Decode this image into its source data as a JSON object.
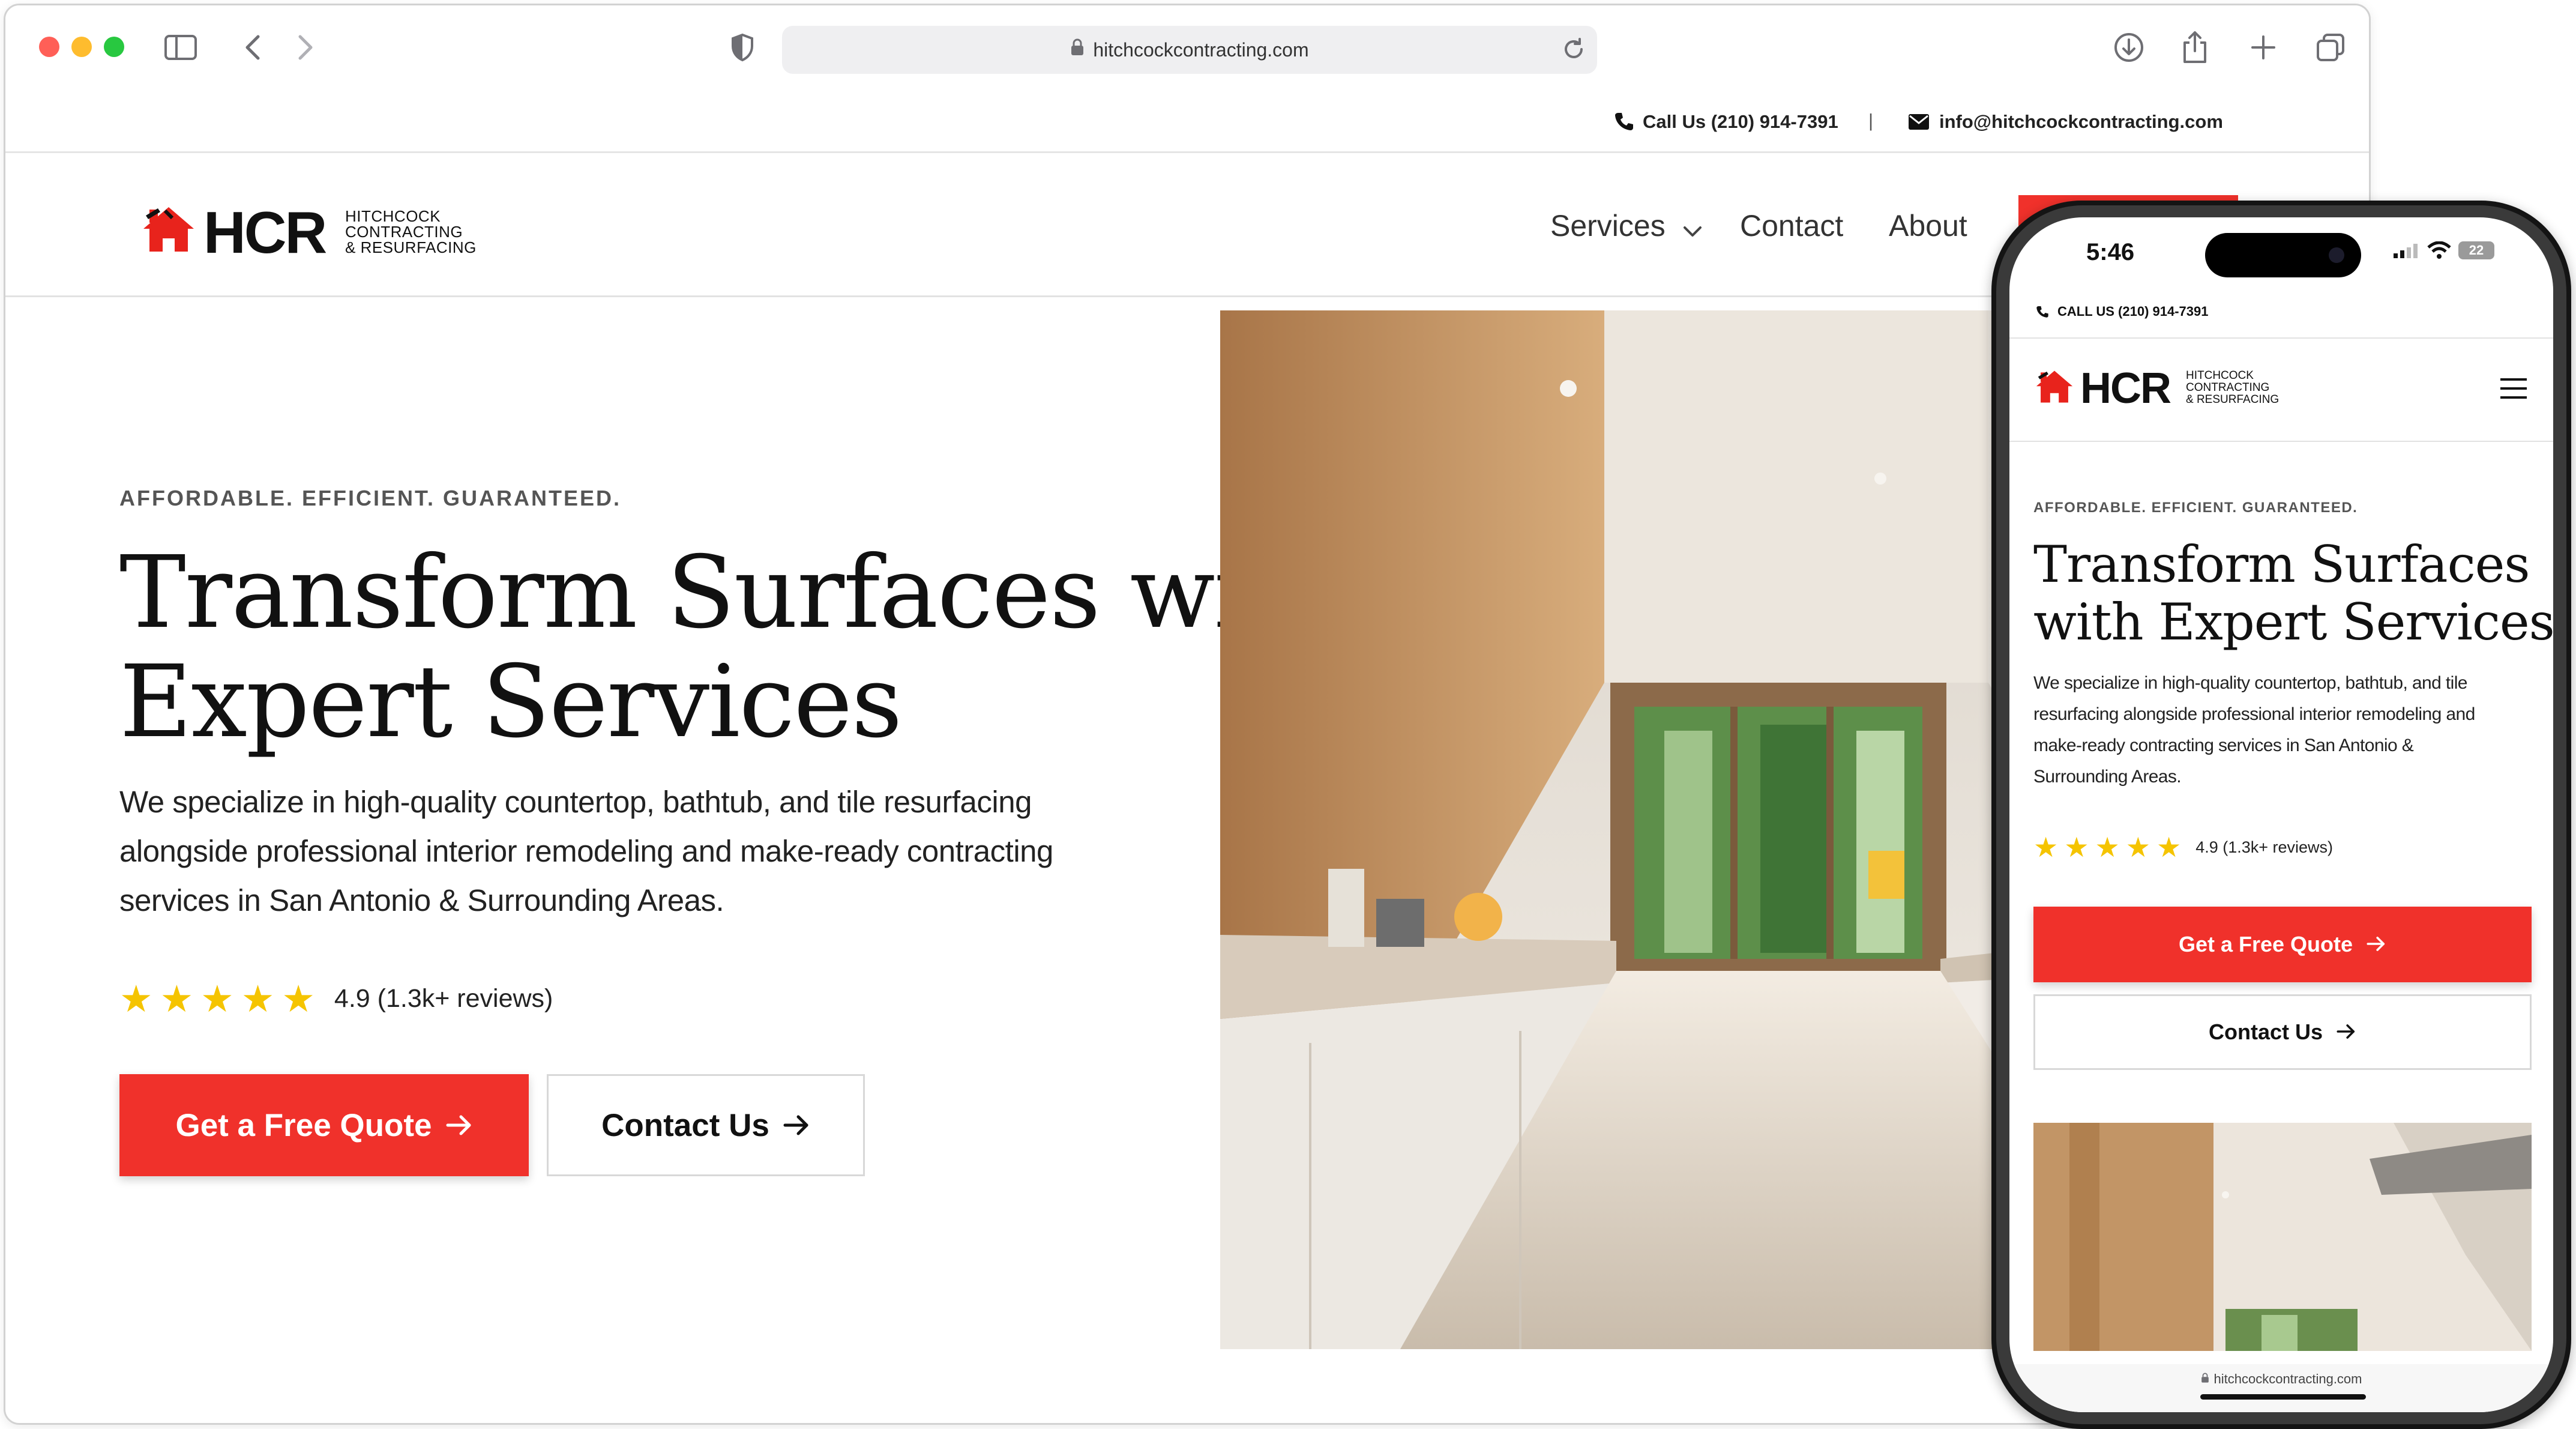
{
  "browser": {
    "url": "hitchcockcontracting.com",
    "controls": [
      "sidebar-icon",
      "back-icon",
      "forward-icon",
      "shield-icon",
      "reload-icon",
      "download-icon",
      "share-icon",
      "new-tab-icon",
      "tabs-icon"
    ]
  },
  "topbar": {
    "phone_label": "Call Us (210) 914-7391",
    "separator": "|",
    "email": "info@hitchcockcontracting.com"
  },
  "logo": {
    "mark": "HCR",
    "line1": "HITCHCOCK",
    "line2": "CONTRACTING",
    "line3": "& RESURFACING"
  },
  "nav": {
    "items": [
      "Services",
      "Contact",
      "About"
    ]
  },
  "hero": {
    "eyebrow": "AFFORDABLE. EFFICIENT. GUARANTEED.",
    "title_line1": "Transform Surfaces with",
    "title_line2": "Expert Services",
    "lead_line1": "We specialize in high-quality countertop, bathtub, and tile resurfacing",
    "lead_line2": "alongside professional interior remodeling and make-ready contracting",
    "lead_line3": "services in San Antonio & Surrounding Areas.",
    "rating_text": "4.9 (1.3k+ reviews)",
    "rating_stars": 5,
    "cta_primary": "Get a Free Quote",
    "cta_secondary": "Contact Us"
  },
  "mobile": {
    "status_time": "5:46",
    "battery": "22",
    "call_label": "CALL US (210) 914-7391",
    "eyebrow": "AFFORDABLE. EFFICIENT. GUARANTEED.",
    "title_line1": "Transform Surfaces",
    "title_line2": "with Expert Services",
    "lead_line1": "We specialize in high-quality countertop, bathtub, and tile",
    "lead_line2": "resurfacing alongside professional interior remodeling and",
    "lead_line3": "make-ready contracting services in San Antonio &",
    "lead_line4": "Surrounding Areas.",
    "rating_text": "4.9 (1.3k+ reviews)",
    "cta_primary": "Get a Free Quote",
    "cta_secondary": "Contact Us",
    "url": "hitchcockcontracting.com"
  },
  "colors": {
    "accent_red": "#f0312b",
    "star_yellow": "#f5c400",
    "text_dark": "#111111"
  }
}
